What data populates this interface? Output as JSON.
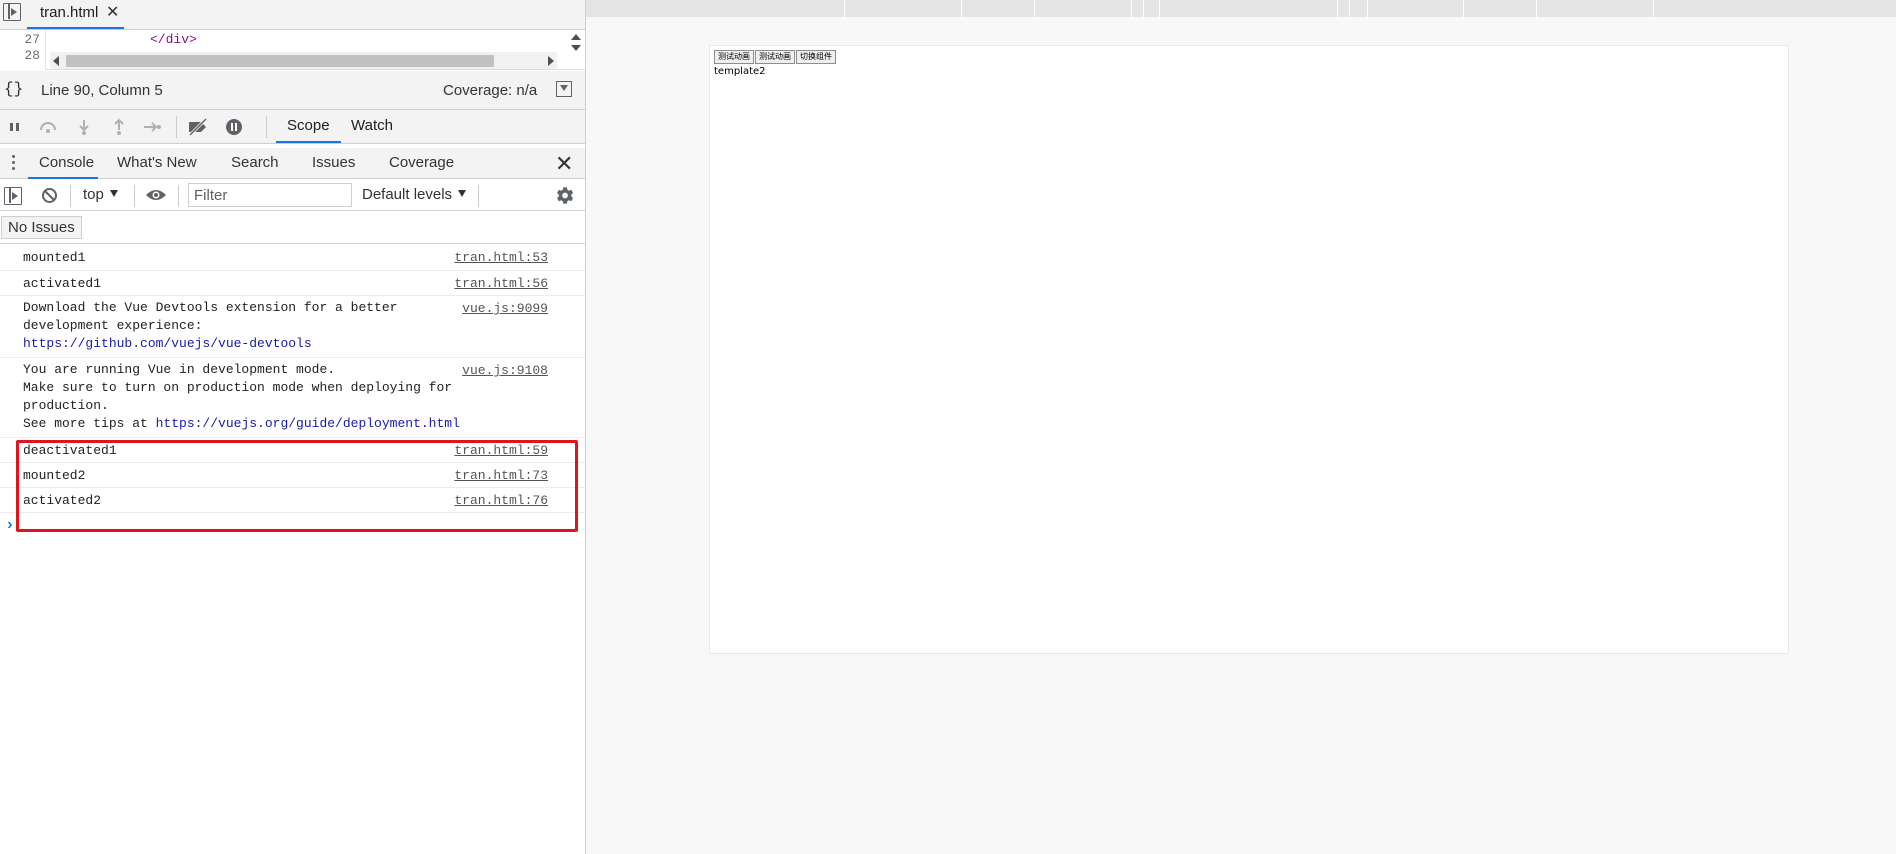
{
  "source_tab": {
    "filename": "tran.html",
    "close": "✕"
  },
  "code": {
    "lines": [
      {
        "number": "27",
        "text": "</div>"
      },
      {
        "number": "28",
        "text": ""
      }
    ]
  },
  "status": {
    "cursor": "Line 90, Column 5",
    "coverage": "Coverage: n/a",
    "braces": "{}"
  },
  "debugger": {
    "tabs": [
      "Scope",
      "Watch"
    ]
  },
  "drawer_tabs": [
    "Console",
    "What's New",
    "Search",
    "Issues",
    "Coverage"
  ],
  "console_toolbar": {
    "context": "top",
    "filter_placeholder": "Filter",
    "levels": "Default levels"
  },
  "issues": "No Issues",
  "messages": [
    {
      "text": "mounted1",
      "source": "tran.html:53"
    },
    {
      "text": "activated1",
      "source": "tran.html:56"
    },
    {
      "text_lines": [
        "Download the Vue Devtools extension for a better",
        "development experience:"
      ],
      "link": "https://github.com/vuejs/vue-devtools",
      "source": "vue.js:9099"
    },
    {
      "text_lines": [
        "You are running Vue in development mode.",
        "Make sure to turn on production mode when deploying for",
        "production."
      ],
      "prefix": "See more tips at ",
      "link": "https://vuejs.org/guide/deployment.html",
      "source": "vue.js:9108"
    },
    {
      "text": "deactivated1",
      "source": "tran.html:59"
    },
    {
      "text": "mounted2",
      "source": "tran.html:73"
    },
    {
      "text": "activated2",
      "source": "tran.html:76"
    }
  ],
  "prompt": "›",
  "colors": {
    "accent": "#1a73e8",
    "highlight": "#e0141d"
  },
  "page": {
    "buttons": [
      "测试动画",
      "测试动画",
      "切换组件"
    ],
    "content": "template2"
  }
}
